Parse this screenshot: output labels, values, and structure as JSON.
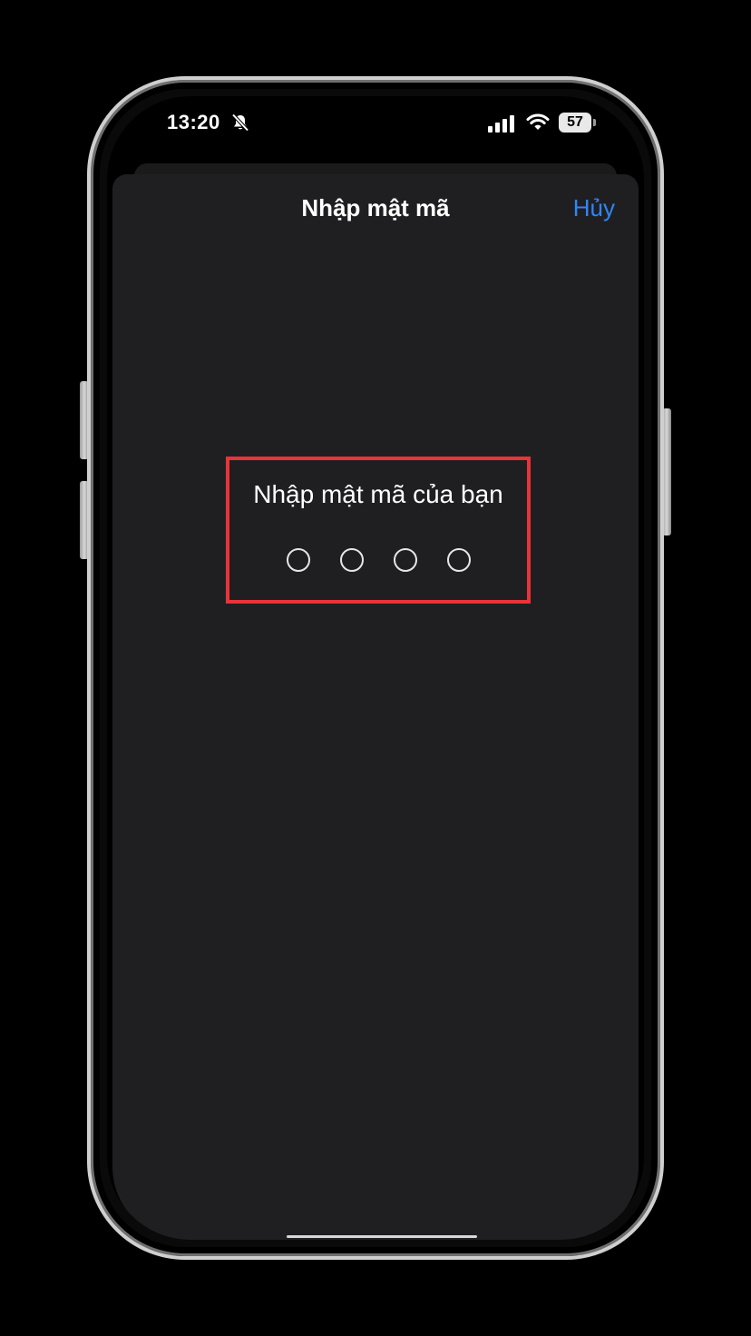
{
  "status_bar": {
    "time": "13:20",
    "battery_level": "57",
    "icons": [
      "bell-slash-icon",
      "cellular-signal-icon",
      "wifi-icon",
      "battery-icon"
    ]
  },
  "sheet": {
    "title": "Nhập mật mã",
    "cancel_label": "Hủy"
  },
  "passcode": {
    "prompt": "Nhập mật mã của bạn",
    "digit_count": 4,
    "entered": 0
  },
  "colors": {
    "accent": "#2f86f5",
    "highlight_border": "#e8333a",
    "sheet_background": "#1f1f22"
  }
}
